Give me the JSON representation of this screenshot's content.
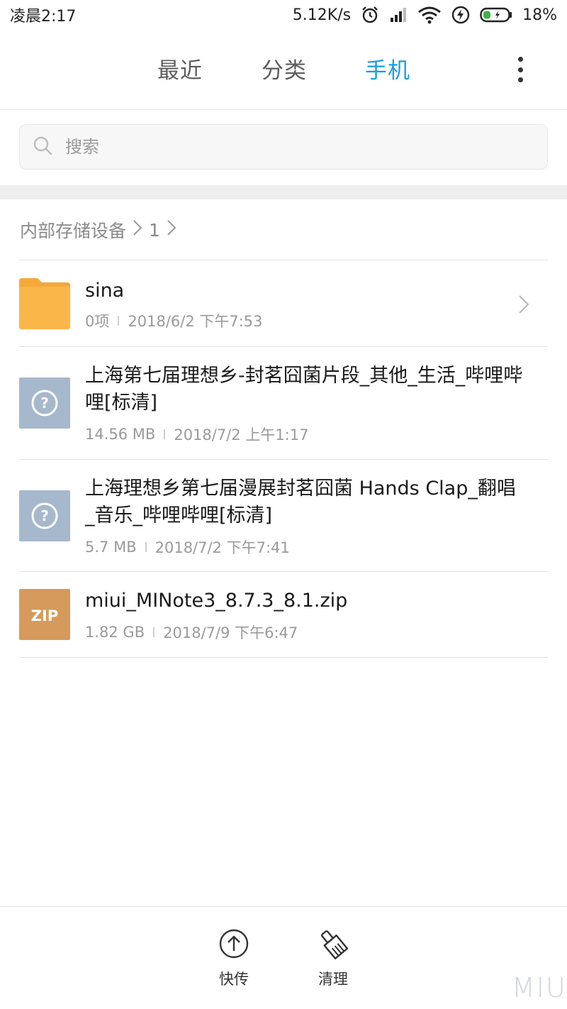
{
  "status_bar": {
    "time": "凌晨2:17",
    "net_speed": "5.12K/s",
    "battery": "18%"
  },
  "tabs": [
    {
      "label": "最近",
      "active": false
    },
    {
      "label": "分类",
      "active": false
    },
    {
      "label": "手机",
      "active": true
    }
  ],
  "search": {
    "placeholder": "搜索"
  },
  "breadcrumb": {
    "root": "内部存储设备",
    "sep": ">",
    "current": "1"
  },
  "files": [
    {
      "name": "sina",
      "size": "0项",
      "date": "2018/6/2 下午7:53",
      "type": "folder-icon"
    },
    {
      "name": "上海第七届理想乡-封茗囧菌片段_其他_生活_哔哩哔哩[标清]",
      "size": "14.56 MB",
      "date": "2018/7/2 上午1:17",
      "type": "unknown-file-icon"
    },
    {
      "name": "上海理想乡第七届漫展封茗囧菌 Hands Clap_翻唱_音乐_哔哩哔哩[标清]",
      "size": "5.7 MB",
      "date": "2018/7/2 下午7:41",
      "type": "unknown-file-icon"
    },
    {
      "name": "miui_MINote3_8.7.3_8.1.zip",
      "size": "1.82 GB",
      "date": "2018/7/9 下午6:47",
      "type": "zip-file-icon",
      "icon_label": "ZIP"
    }
  ],
  "bottom_actions": [
    {
      "label": "快传",
      "icon": "upload-arrow-icon"
    },
    {
      "label": "清理",
      "icon": "broom-icon"
    }
  ],
  "watermark": "MIUI",
  "colors": {
    "accent": "#1a9be6",
    "folder": "#fbb64a",
    "unknown_file": "#a6b8cc",
    "zip_file": "#d69a5c"
  }
}
